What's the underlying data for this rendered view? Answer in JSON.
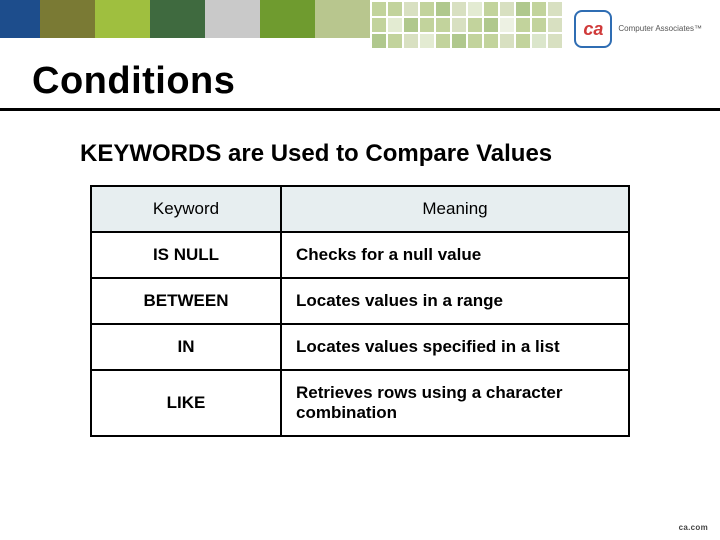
{
  "brand": {
    "logo_mark": "ca",
    "logo_text": "Computer Associates™"
  },
  "title": "Conditions",
  "subheading": "KEYWORDS are Used to Compare Values",
  "table": {
    "head": {
      "keyword": "Keyword",
      "meaning": "Meaning"
    },
    "rows": [
      {
        "keyword": "IS NULL",
        "meaning": "Checks for a null value"
      },
      {
        "keyword": "BETWEEN",
        "meaning": "Locates values in a range"
      },
      {
        "keyword": "IN",
        "meaning": "Locates values specified in a list"
      },
      {
        "keyword": "LIKE",
        "meaning": "Retrieves rows using a character combination"
      }
    ]
  },
  "footer": "ca.com"
}
